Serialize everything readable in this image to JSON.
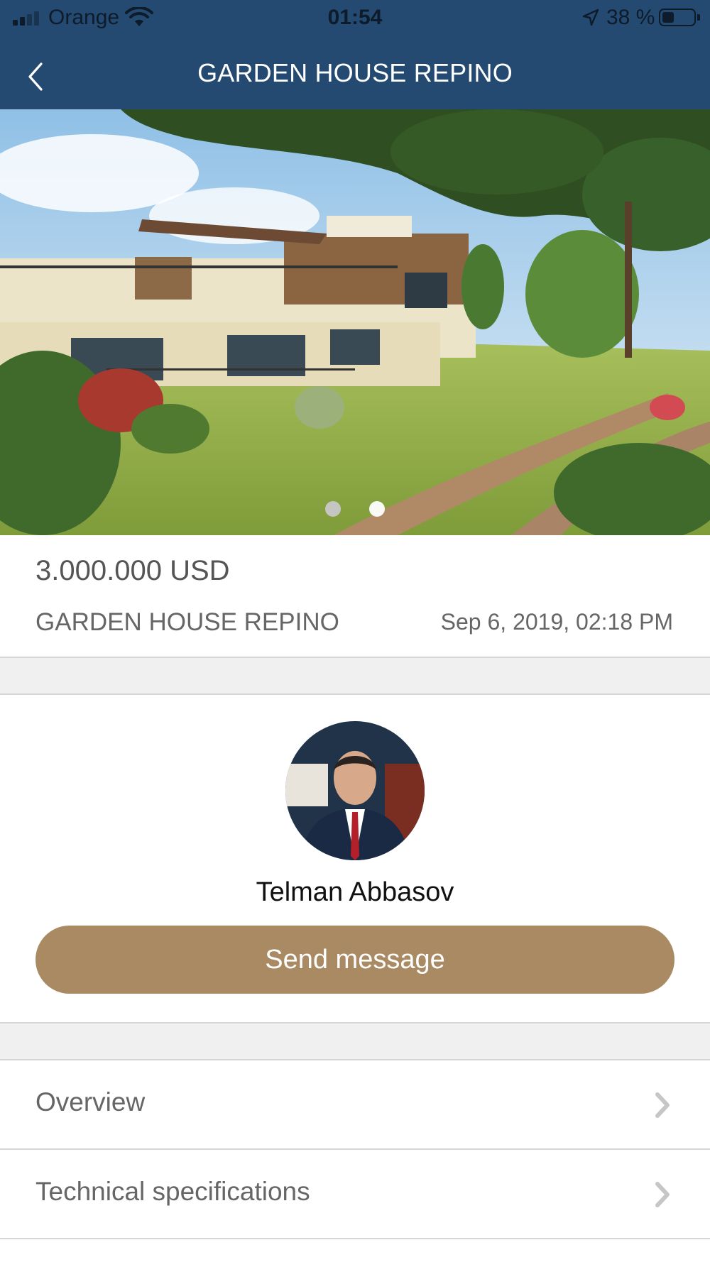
{
  "status_bar": {
    "carrier": "Orange",
    "time": "01:54",
    "battery_percent": "38 %",
    "battery_level": 0.38,
    "signal_bars": 2
  },
  "nav": {
    "title": "GARDEN HOUSE REPINO",
    "back_icon": "chevron-left-icon"
  },
  "gallery": {
    "total_pages": 2,
    "current_page": 1
  },
  "listing": {
    "price": "3.000.000 USD",
    "title": "GARDEN HOUSE REPINO",
    "date": "Sep 6, 2019, 02:18 PM"
  },
  "agent": {
    "name": "Telman Abbasov",
    "send_label": "Send message"
  },
  "menu": [
    {
      "label": "Overview",
      "icon": "chevron-right-icon"
    },
    {
      "label": "Technical specifications",
      "icon": "chevron-right-icon"
    }
  ],
  "colors": {
    "nav_bg": "#244a72",
    "button": "#a98a62"
  }
}
